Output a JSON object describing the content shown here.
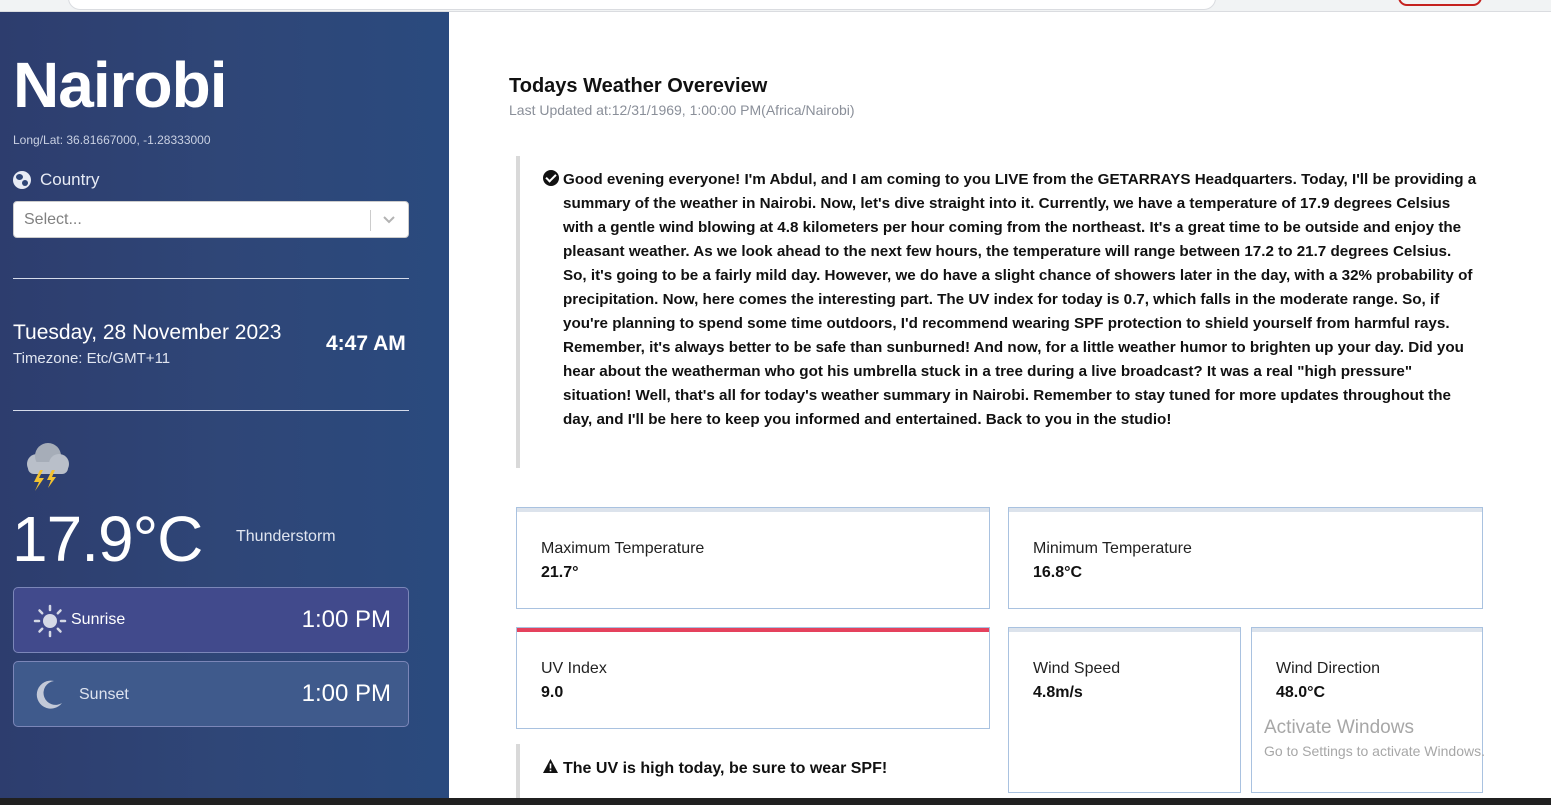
{
  "sidebar": {
    "city": "Nairobi",
    "coords": "Long/Lat: 36.81667000, -1.28333000",
    "country_label": "Country",
    "country_select": {
      "placeholder": "Select..."
    },
    "date": "Tuesday, 28 November 2023",
    "timezone": "Timezone: Etc/GMT+11",
    "time": "4:47 AM",
    "weather_icon": "thunderstorm-cloud-icon",
    "temperature": "17.9°C",
    "condition": "Thunderstorm",
    "sunrise": {
      "label": "Sunrise",
      "time": "1:00 PM",
      "icon": "sun-icon"
    },
    "sunset": {
      "label": "Sunset",
      "time": "1:00 PM",
      "icon": "moon-icon"
    }
  },
  "main": {
    "title": "Todays Weather Overeview",
    "updated": "Last Updated at:12/31/1969, 1:00:00 PM(Africa/Nairobi)",
    "summary": "Good evening everyone! I'm Abdul, and I am coming to you LIVE from the GETARRAYS Headquarters. Today, I'll be providing a summary of the weather in Nairobi. Now, let's dive straight into it. Currently, we have a temperature of 17.9 degrees Celsius with a gentle wind blowing at 4.8 kilometers per hour coming from the northeast. It's a great time to be outside and enjoy the pleasant weather. As we look ahead to the next few hours, the temperature will range between 17.2 to 21.7 degrees Celsius. So, it's going to be a fairly mild day. However, we do have a slight chance of showers later in the day, with a 32% probability of precipitation. Now, here comes the interesting part. The UV index for today is 0.7, which falls in the moderate range. So, if you're planning to spend some time outdoors, I'd recommend wearing SPF protection to shield yourself from harmful rays. Remember, it's always better to be safe than sunburned! And now, for a little weather humor to brighten up your day. Did you hear about the weatherman who got his umbrella stuck in a tree during a live broadcast? It was a real \"high pressure\" situation! Well, that's all for today's weather summary in Nairobi. Remember to stay tuned for more updates throughout the day, and I'll be here to keep you informed and entertained. Back to you in the studio!",
    "cards": {
      "max_temp": {
        "label": "Maximum Temperature",
        "value": "21.7°"
      },
      "min_temp": {
        "label": "Minimum Temperature",
        "value": "16.8°C"
      },
      "uv": {
        "label": "UV Index",
        "value": "9.0"
      },
      "wind_speed": {
        "label": "Wind Speed",
        "value": "4.8m/s"
      },
      "wind_dir": {
        "label": "Wind Direction",
        "value": "48.0°C"
      }
    },
    "uv_warning": "The UV is high today, be sure to wear SPF!"
  },
  "watermark": {
    "line1": "Activate Windows",
    "line2": "Go to Settings to activate Windows."
  },
  "colors": {
    "sidebar_bg": "#2f4677",
    "sunrise_card": "#414a8c",
    "sunset_card": "#3f5a8c",
    "uv_accent": "#e5415d",
    "card_border": "#a9c2e0"
  }
}
